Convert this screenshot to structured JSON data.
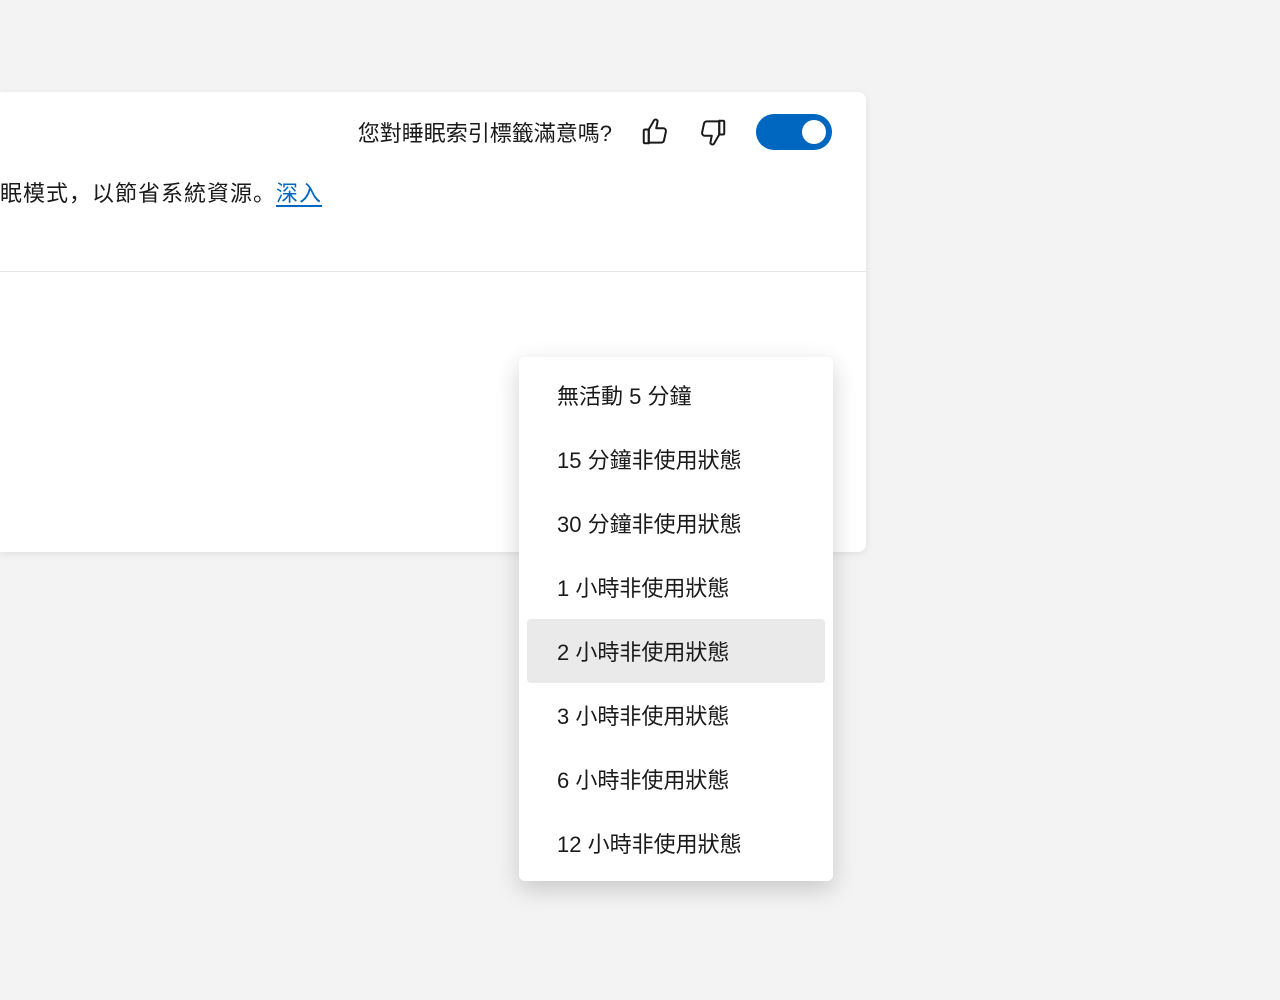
{
  "header": {
    "feedback_question": "您對睡眠索引標籤滿意嗎?"
  },
  "description": {
    "text_fragment": "眠模式，以節省系統資源。",
    "link_label": "深入"
  },
  "select": {
    "current": "2 小時非使用狀態",
    "options": [
      "無活動 5 分鐘",
      "15 分鐘非使用狀態",
      "30 分鐘非使用狀態",
      "1 小時非使用狀態",
      "2 小時非使用狀態",
      "3 小時非使用狀態",
      "6 小時非使用狀態",
      "12 小時非使用狀態"
    ],
    "selected_index": 4
  }
}
